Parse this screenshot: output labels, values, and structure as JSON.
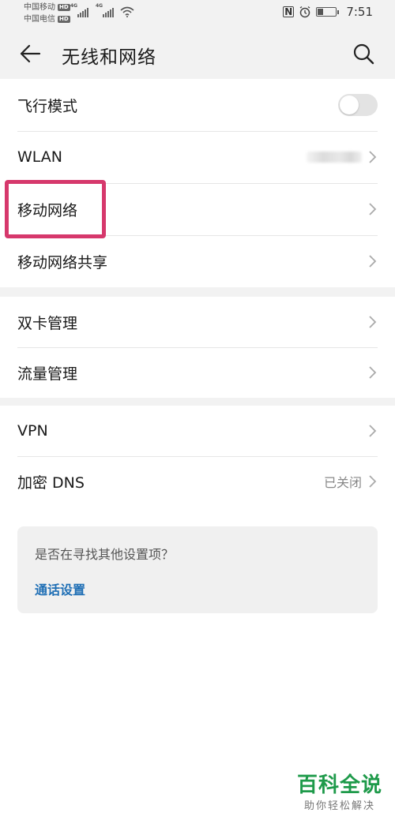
{
  "status_bar": {
    "carrier1": "中国移动",
    "carrier2": "中国电信",
    "hd_badge": "HD",
    "network_badge": "4G",
    "time": "7:51",
    "icons": [
      "nfc-icon",
      "alarm-icon",
      "battery-icon",
      "wifi-icon",
      "signal-icon"
    ]
  },
  "header": {
    "title": "无线和网络",
    "back_icon": "arrow-left-icon",
    "search_icon": "search-icon"
  },
  "section1": [
    {
      "label": "飞行模式",
      "type": "toggle",
      "state": "off"
    },
    {
      "label": "WLAN",
      "type": "link",
      "value_blurred": true
    },
    {
      "label": "移动网络",
      "type": "link",
      "highlighted": true
    },
    {
      "label": "移动网络共享",
      "type": "link"
    }
  ],
  "section2": [
    {
      "label": "双卡管理",
      "type": "link"
    },
    {
      "label": "流量管理",
      "type": "link"
    }
  ],
  "section3": [
    {
      "label": "VPN",
      "type": "link"
    },
    {
      "label": "加密 DNS",
      "type": "link",
      "value": "已关闭"
    }
  ],
  "suggestion": {
    "question": "是否在寻找其他设置项？",
    "link": "通话设置"
  },
  "watermark": {
    "title": "百科全说",
    "subtitle": "助你轻松解决"
  },
  "colors": {
    "highlight": "#d6386c",
    "link": "#1f6fb5",
    "background_gray": "#f2f2f2",
    "watermark_green": "#1e9a4a"
  }
}
